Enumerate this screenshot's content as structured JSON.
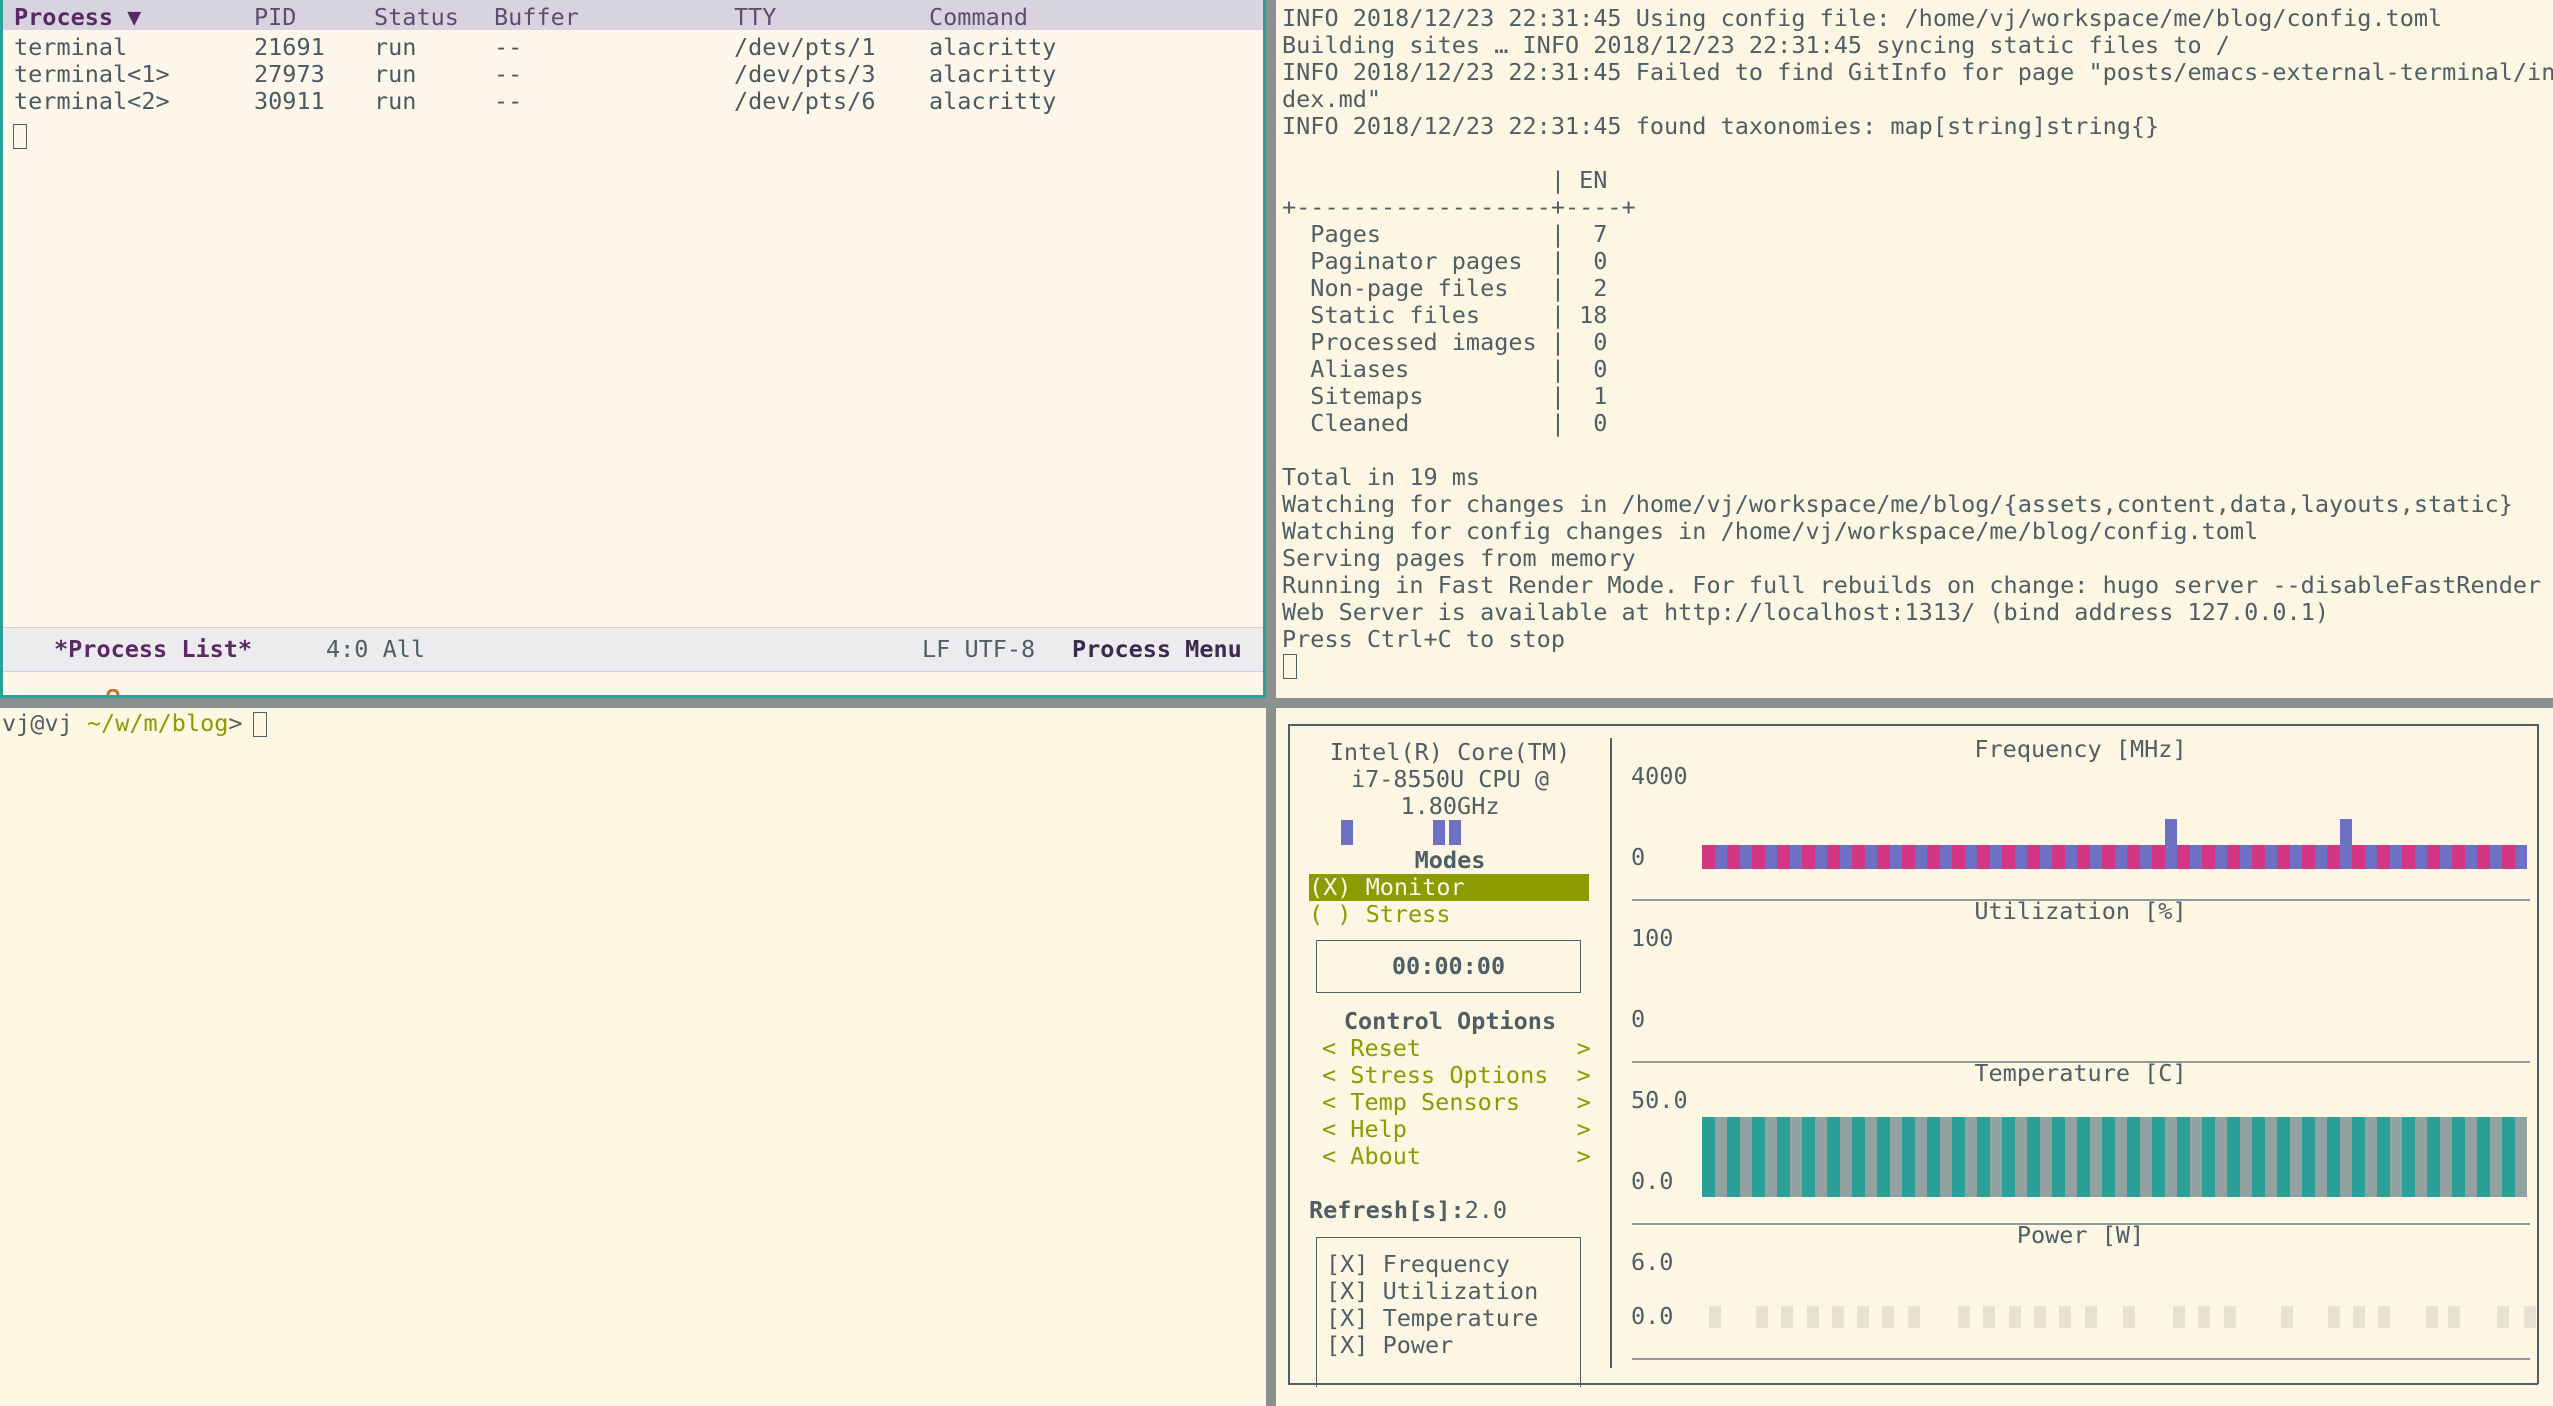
{
  "process_list": {
    "headers": [
      "Process ▼",
      "PID",
      "Status",
      "Buffer",
      "TTY",
      "Command"
    ],
    "rows": [
      [
        "terminal",
        "21691",
        "run",
        "--",
        "/dev/pts/1",
        "alacritty"
      ],
      [
        "terminal<1>",
        "27973",
        "run",
        "--",
        "/dev/pts/3",
        "alacritty"
      ],
      [
        "terminal<2>",
        "30911",
        "run",
        "--",
        "/dev/pts/6",
        "alacritty"
      ]
    ],
    "modeline": {
      "buffer_name": "*Process List*",
      "position": "4:0 All",
      "encoding": "LF UTF-8",
      "menu": "Process Menu"
    }
  },
  "hugo_log": {
    "lines": [
      "INFO 2018/12/23 22:31:45 Using config file: /home/vj/workspace/me/blog/config.toml",
      "Building sites … INFO 2018/12/23 22:31:45 syncing static files to /",
      "INFO 2018/12/23 22:31:45 Failed to find GitInfo for page \"posts/emacs-external-terminal/in",
      "dex.md\"",
      "INFO 2018/12/23 22:31:45 found taxonomies: map[string]string{}",
      "",
      "                   | EN",
      "+------------------+----+",
      "  Pages            |  7",
      "  Paginator pages  |  0",
      "  Non-page files   |  2",
      "  Static files     | 18",
      "  Processed images |  0",
      "  Aliases          |  0",
      "  Sitemaps         |  1",
      "  Cleaned          |  0",
      "",
      "Total in 19 ms",
      "Watching for changes in /home/vj/workspace/me/blog/{assets,content,data,layouts,static}",
      "Watching for config changes in /home/vj/workspace/me/blog/config.toml",
      "Serving pages from memory",
      "Running in Fast Render Mode. For full rebuilds on change: hugo server --disableFastRender",
      "Web Server is available at http://localhost:1313/ (bind address 127.0.0.1)",
      "Press Ctrl+C to stop"
    ]
  },
  "shell": {
    "user": "vj@vj",
    "path": "~/w/m/blog",
    "symbol": ">"
  },
  "stui": {
    "cpu_name": [
      "Intel(R) Core(TM)",
      "i7-8550U CPU @",
      "1.80GHz"
    ],
    "modes_title": "Modes",
    "mode_monitor": "(X) Monitor",
    "mode_stress": "( ) Stress",
    "timer": "00:00:00",
    "control_title": "Control Options",
    "controls": [
      "< Reset           >",
      "< Stress Options  >",
      "< Temp Sensors    >",
      "< Help            >",
      "< About           >"
    ],
    "refresh_label": "Refresh[s]:",
    "refresh_value": "2.0",
    "graph_toggles": [
      "[X] Frequency",
      "[X] Utilization",
      "[X] Temperature",
      "[X] Power"
    ],
    "graphs": {
      "frequency": {
        "title": "Frequency [MHz]",
        "max": "4000",
        "min": "0"
      },
      "utilization": {
        "title": "Utilization [%]",
        "max": "100",
        "min": "0"
      },
      "temperature": {
        "title": "Temperature [C]",
        "max": "50.0",
        "min": "0.0"
      },
      "power": {
        "title": "Power [W]",
        "max": "6.0",
        "min": "0.0"
      }
    },
    "colors": {
      "freq_a": "#d33682",
      "freq_b": "#6c71c4",
      "temp_a": "#2aa198",
      "temp_b": "#93a1a1",
      "power_bar": "#e8e2d0",
      "olive": "#8c9b00"
    }
  }
}
